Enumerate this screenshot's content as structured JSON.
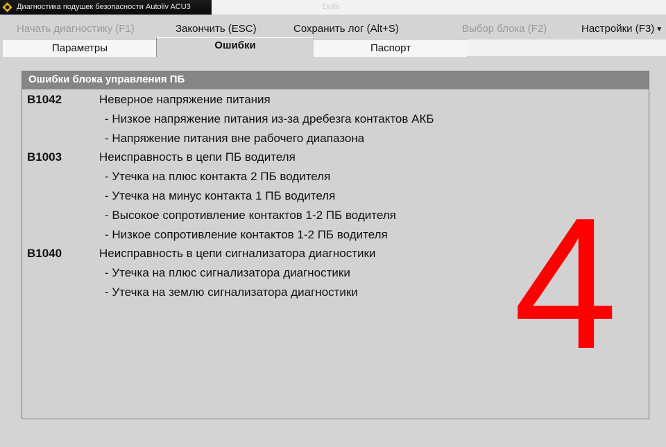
{
  "window": {
    "title": "Диагностика подушек безопасности Autoliv ACU3",
    "background_text": "Dolls"
  },
  "menu": {
    "start": "Начать диагностику (F1)",
    "finish": "Закончить (ESC)",
    "save_log": "Сохранить лог (Alt+S)",
    "select_block": "Выбор блока (F2)",
    "settings": "Настройки (F3)"
  },
  "tabs": [
    {
      "label": "Параметры",
      "active": false
    },
    {
      "label": "Ошибки",
      "active": true
    },
    {
      "label": "Паспорт",
      "active": false
    }
  ],
  "panel": {
    "header": "Ошибки блока управления ПБ"
  },
  "errors": [
    {
      "code": "B1042",
      "description": "Неверное напряжение питания",
      "details": [
        "- Низкое напряжение питания из-за дребезга контактов АКБ",
        "- Напряжение питания вне рабочего диапазона"
      ]
    },
    {
      "code": "B1003",
      "description": "Неисправность в цепи ПБ водителя",
      "details": [
        "- Утечка на плюс контакта 2 ПБ водителя",
        "- Утечка на минус контакта 1 ПБ водителя",
        "- Высокое сопротивление контактов 1-2 ПБ водителя",
        "- Низкое сопротивление контактов 1-2 ПБ водителя"
      ]
    },
    {
      "code": "B1040",
      "description": "Неисправность в цепи сигнализатора диагностики",
      "details": [
        "- Утечка на плюс сигнализатора диагностики",
        "- Утечка на землю сигнализатора диагностики"
      ]
    }
  ],
  "overlay_number": "4",
  "colors": {
    "accent_red": "#ff0000",
    "panel_header": "#858585",
    "disabled_text": "#9a9a9a"
  }
}
